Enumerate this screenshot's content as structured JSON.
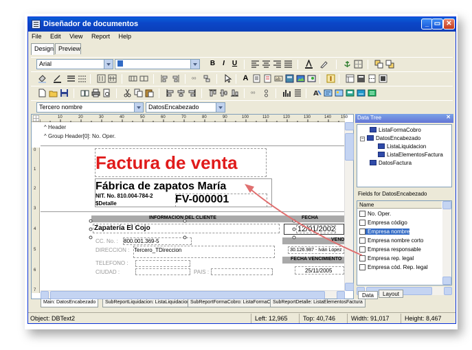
{
  "window": {
    "title": "Diseñador de documentos",
    "min_label": "_",
    "max_label": "▭",
    "close_label": "✕"
  },
  "menu": [
    "File",
    "Edit",
    "View",
    "Report",
    "Help"
  ],
  "tabs": [
    "Design",
    "Preview"
  ],
  "toolbar1": {
    "font": "Arial",
    "size": "",
    "bold": "B",
    "italic": "I",
    "underline": "U"
  },
  "toolbar2": {
    "text_tool": "A"
  },
  "toolbar4": {
    "datasource": "Tercero nombre",
    "dataset": "DatosEncabezado"
  },
  "ruler": {
    "marks": [
      "10",
      "20",
      "30",
      "40",
      "50",
      "60",
      "70",
      "80",
      "90",
      "100",
      "110",
      "120",
      "130",
      "140",
      "150"
    ],
    "vmarks": [
      "0",
      "1",
      "2",
      "3",
      "4",
      "5",
      "6",
      "7"
    ]
  },
  "bands": {
    "header": "Header",
    "group_header": "Group Header[0]: No. Oper."
  },
  "report": {
    "title": "Factura de venta",
    "company": "Fábrica de zapatos María",
    "nit": "NIT. No. 810.004-784-2",
    "detail": "$Detalle",
    "invoice_number": "FV-000001",
    "client_header": "INFORMACION DEL CLIENTE",
    "date_header": "FECHA",
    "client_name": "Zapatería El Cojo",
    "date_value": "12/01/2002",
    "cc_label": "CC. No. :",
    "cc_value": "800.001.369-5",
    "seller_header": "VENDE",
    "address_label": "DIRECCION :",
    "address_value": "Tercero_TDireccion",
    "seller_value": "30.126.987 - Iván Lopez",
    "phone_label": "TELEFONO :",
    "due_header": "FECHA VENCIMIENTO",
    "city_label": "CIUDAD :",
    "country_label": "PAIS :",
    "due_value": "25/11/2005"
  },
  "bottom_tabs": [
    "Main: DatosEncabezado",
    "SubReportLiquidacion: ListaLiquidacion",
    "SubReportFormaCobro: ListaFormaCobro",
    "SubReportDetalle: ListaElementosFactura"
  ],
  "status": {
    "object": "Object: DBText2",
    "left": "Left: 12,965",
    "top": "Top: 40,746",
    "width": "Width: 91,017",
    "height": "Height: 8,467"
  },
  "data_tree": {
    "title": "Data Tree",
    "close": "✕",
    "items": [
      "ListaFormaCobro",
      "DatosEncabezado",
      "ListaLiquidacion",
      "ListaElementosFactura",
      "DatosFactura"
    ]
  },
  "fields": {
    "title": "Fields for DatosEncabezado",
    "column": "Name",
    "items": [
      "No. Oper.",
      "Empresa código",
      "Empresa nombre",
      "Empresa nombre corto",
      "Empresa responsable",
      "Empresa rep. legal",
      "Empresa cód. Rep. legal"
    ],
    "selected_index": 2
  },
  "panel_tabs": [
    "Data",
    "Layout"
  ]
}
